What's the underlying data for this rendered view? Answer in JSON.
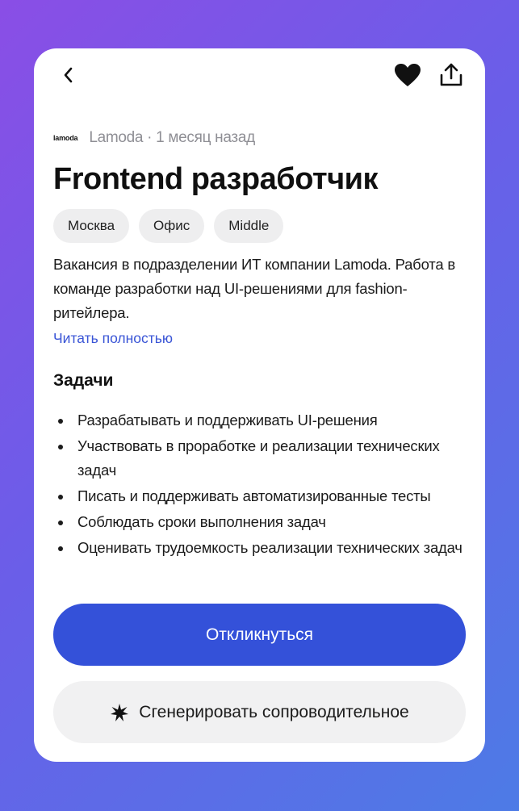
{
  "company": {
    "logo_text": "lamoda",
    "meta": "Lamoda · 1 месяц назад"
  },
  "job": {
    "title": "Frontend разработчик",
    "tags": [
      "Москва",
      "Офис",
      "Middle"
    ],
    "description": "Вакансия в подразделении ИТ компании Lamoda. Работа в команде разработки над UI-решениями для fashion-ритейлера.",
    "read_more": "Читать полностью"
  },
  "tasks": {
    "title": "Задачи",
    "items": [
      "Разрабатывать и поддерживать UI-решения",
      "Участвовать в проработке и реализации технических задач",
      "Писать и поддерживать автоматизированные тесты",
      "Соблюдать сроки выполнения задач",
      "Оценивать трудоемкость реализации технических задач"
    ]
  },
  "actions": {
    "respond": "Откликнуться",
    "generate": "Сгенерировать сопроводительное"
  },
  "icons": {
    "back": "chevron-left-icon",
    "like": "heart-icon",
    "share": "share-icon",
    "sparkle": "sparkle-icon"
  },
  "colors": {
    "accent": "#3451d9",
    "link": "#3a55d6"
  }
}
